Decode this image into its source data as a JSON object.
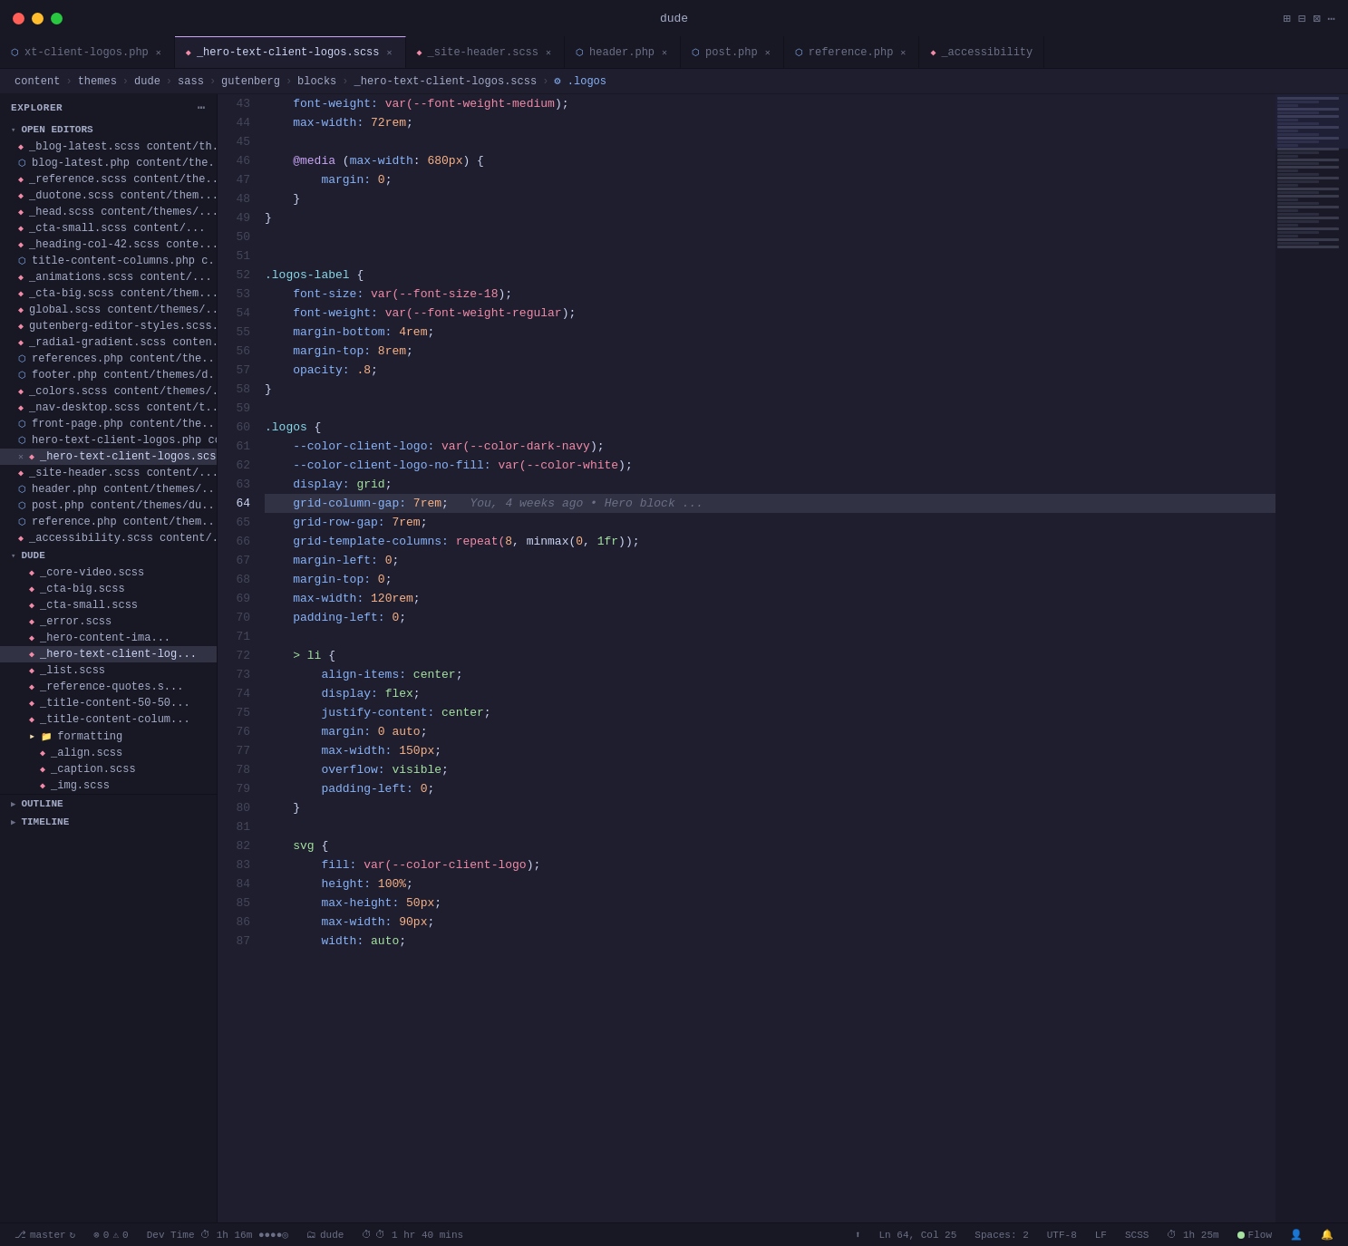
{
  "titlebar": {
    "title": "dude",
    "buttons": [
      "close",
      "minimize",
      "maximize"
    ],
    "icons": [
      "⊞",
      "⊟",
      "⊠",
      "⋯"
    ]
  },
  "tabs": [
    {
      "label": "xt-client-logos.php",
      "type": "php",
      "active": false,
      "closable": true
    },
    {
      "label": "_hero-text-client-logos.scss",
      "type": "scss",
      "active": true,
      "closable": true
    },
    {
      "label": "_site-header.scss",
      "type": "scss",
      "active": false,
      "closable": true
    },
    {
      "label": "header.php",
      "type": "php",
      "active": false,
      "closable": true
    },
    {
      "label": "post.php",
      "type": "php",
      "active": false,
      "closable": true
    },
    {
      "label": "reference.php",
      "type": "php",
      "active": false,
      "closable": true
    },
    {
      "label": "_accessibility",
      "type": "scss",
      "active": false,
      "closable": false
    }
  ],
  "breadcrumb": {
    "parts": [
      "content",
      "themes",
      "dude",
      "sass",
      "gutenberg",
      "blocks",
      "_hero-text-client-logos.scss",
      ".logos"
    ]
  },
  "sidebar": {
    "title": "EXPLORER",
    "sections": {
      "open_editors": {
        "label": "OPEN EDITORS",
        "files": [
          {
            "name": "_blog-latest.scss",
            "path": "content/th...",
            "type": "scss"
          },
          {
            "name": "blog-latest.php",
            "path": "content/the...",
            "type": "php"
          },
          {
            "name": "_reference.scss",
            "path": "content/the...",
            "type": "scss"
          },
          {
            "name": "_duotone.scss",
            "path": "content/them...",
            "type": "scss"
          },
          {
            "name": "_head.scss",
            "path": "content/themes/...",
            "type": "scss"
          },
          {
            "name": "_cta-small.scss",
            "path": "content/...",
            "type": "scss"
          },
          {
            "name": "_heading-col-42.scss",
            "path": "conte...",
            "type": "scss"
          },
          {
            "name": "title-content-columns.php",
            "path": "c...",
            "type": "php"
          },
          {
            "name": "_animations.scss",
            "path": "content/...",
            "type": "scss"
          },
          {
            "name": "_cta-big.scss",
            "path": "content/them...",
            "type": "scss"
          },
          {
            "name": "global.scss",
            "path": "content/themes/...",
            "type": "scss"
          },
          {
            "name": "gutenberg-editor-styles.scss...",
            "path": "",
            "type": "scss"
          },
          {
            "name": "_radial-gradient.scss",
            "path": "conten...",
            "type": "scss"
          },
          {
            "name": "references.php",
            "path": "content/the...",
            "type": "php"
          },
          {
            "name": "footer.php",
            "path": "content/themes/d...",
            "type": "php"
          },
          {
            "name": "_colors.scss",
            "path": "content/themes/...",
            "type": "scss"
          },
          {
            "name": "_nav-desktop.scss",
            "path": "content/t...",
            "type": "scss"
          },
          {
            "name": "front-page.php",
            "path": "content/the...",
            "type": "php"
          },
          {
            "name": "hero-text-client-logos.php",
            "path": "content/...",
            "type": "php"
          },
          {
            "name": "_hero-text-client-logos.scss...",
            "path": "",
            "type": "scss",
            "active": true,
            "modified": true
          },
          {
            "name": "_site-header.scss",
            "path": "content/...",
            "type": "scss"
          },
          {
            "name": "header.php",
            "path": "content/themes/...",
            "type": "php"
          },
          {
            "name": "post.php",
            "path": "content/themes/du...",
            "type": "php"
          },
          {
            "name": "reference.php",
            "path": "content/them...",
            "type": "php"
          },
          {
            "name": "_accessibility.scss",
            "path": "content/...",
            "type": "scss"
          }
        ]
      },
      "dude": {
        "label": "DUDE",
        "files": [
          {
            "name": "_core-video.scss",
            "indent": 1
          },
          {
            "name": "_cta-big.scss",
            "indent": 1
          },
          {
            "name": "_cta-small.scss",
            "indent": 1
          },
          {
            "name": "_error.scss",
            "indent": 1
          },
          {
            "name": "_hero-content-ima...",
            "indent": 1
          },
          {
            "name": "_hero-text-client-log...",
            "indent": 1,
            "active": true
          },
          {
            "name": "_list.scss",
            "indent": 1
          },
          {
            "name": "_reference-quotes.s...",
            "indent": 1
          },
          {
            "name": "_title-content-50-50...",
            "indent": 1
          },
          {
            "name": "_title-content-colum...",
            "indent": 1
          },
          {
            "name": "formatting",
            "indent": 1,
            "type": "folder"
          },
          {
            "name": "_align.scss",
            "indent": 2
          },
          {
            "name": "_caption.scss",
            "indent": 2
          },
          {
            "name": "_img.scss",
            "indent": 2
          }
        ]
      },
      "outline": {
        "label": "OUTLINE"
      },
      "timeline": {
        "label": "TIMELINE"
      }
    }
  },
  "code": {
    "lines": [
      {
        "num": 43,
        "content": [
          {
            "t": "    font-weight: ",
            "c": "prop"
          },
          {
            "t": "var(",
            "c": "fn"
          },
          {
            "t": "--font-weight-medium",
            "c": "fn"
          },
          {
            "t": ");",
            "c": "punct"
          }
        ]
      },
      {
        "num": 44,
        "content": [
          {
            "t": "    max-width: ",
            "c": "prop"
          },
          {
            "t": "72rem",
            "c": "num"
          },
          {
            "t": ";",
            "c": "punct"
          }
        ]
      },
      {
        "num": 45,
        "content": []
      },
      {
        "num": 46,
        "content": [
          {
            "t": "    @media ",
            "c": "at"
          },
          {
            "t": "(",
            "c": "punct"
          },
          {
            "t": "max-width",
            "c": "prop"
          },
          {
            "t": ": ",
            "c": "punct"
          },
          {
            "t": "680px",
            "c": "num"
          },
          {
            "t": ") {",
            "c": "punct"
          }
        ]
      },
      {
        "num": 47,
        "content": [
          {
            "t": "        margin: ",
            "c": "prop"
          },
          {
            "t": "0",
            "c": "num"
          },
          {
            "t": ";",
            "c": "punct"
          }
        ]
      },
      {
        "num": 48,
        "content": [
          {
            "t": "    }",
            "c": "punct"
          }
        ]
      },
      {
        "num": 49,
        "content": [
          {
            "t": "}",
            "c": "punct"
          }
        ]
      },
      {
        "num": 50,
        "content": []
      },
      {
        "num": 51,
        "content": []
      },
      {
        "num": 52,
        "content": [
          {
            "t": ".logos-label ",
            "c": "sel-class"
          },
          {
            "t": "{",
            "c": "punct"
          }
        ]
      },
      {
        "num": 53,
        "content": [
          {
            "t": "    font-size: ",
            "c": "prop"
          },
          {
            "t": "var(",
            "c": "fn"
          },
          {
            "t": "--font-size-18",
            "c": "fn"
          },
          {
            "t": ");",
            "c": "punct"
          }
        ]
      },
      {
        "num": 54,
        "content": [
          {
            "t": "    font-weight: ",
            "c": "prop"
          },
          {
            "t": "var(",
            "c": "fn"
          },
          {
            "t": "--font-weight-regular",
            "c": "fn"
          },
          {
            "t": ");",
            "c": "punct"
          }
        ]
      },
      {
        "num": 55,
        "content": [
          {
            "t": "    margin-bottom: ",
            "c": "prop"
          },
          {
            "t": "4rem",
            "c": "num"
          },
          {
            "t": ";",
            "c": "punct"
          }
        ]
      },
      {
        "num": 56,
        "content": [
          {
            "t": "    margin-top: ",
            "c": "prop"
          },
          {
            "t": "8rem",
            "c": "num"
          },
          {
            "t": ";",
            "c": "punct"
          }
        ]
      },
      {
        "num": 57,
        "content": [
          {
            "t": "    opacity: ",
            "c": "prop"
          },
          {
            "t": ".8",
            "c": "num"
          },
          {
            "t": ";",
            "c": "punct"
          }
        ]
      },
      {
        "num": 58,
        "content": [
          {
            "t": "}",
            "c": "punct"
          }
        ]
      },
      {
        "num": 59,
        "content": []
      },
      {
        "num": 60,
        "content": [
          {
            "t": ".logos ",
            "c": "sel-class"
          },
          {
            "t": "{",
            "c": "punct"
          }
        ]
      },
      {
        "num": 61,
        "content": [
          {
            "t": "    --color-client-logo: ",
            "c": "prop"
          },
          {
            "t": "var(",
            "c": "fn"
          },
          {
            "t": "--color-dark-navy",
            "c": "fn"
          },
          {
            "t": ");",
            "c": "punct"
          }
        ]
      },
      {
        "num": 62,
        "content": [
          {
            "t": "    --color-client-logo-no-fill: ",
            "c": "prop"
          },
          {
            "t": "var(",
            "c": "fn"
          },
          {
            "t": "--color-white",
            "c": "fn"
          },
          {
            "t": ");",
            "c": "punct"
          }
        ]
      },
      {
        "num": 63,
        "content": [
          {
            "t": "    display: ",
            "c": "prop"
          },
          {
            "t": "grid",
            "c": "val"
          },
          {
            "t": ";",
            "c": "punct"
          }
        ]
      },
      {
        "num": 64,
        "content": [
          {
            "t": "    grid-column-gap: ",
            "c": "prop"
          },
          {
            "t": "7rem",
            "c": "num"
          },
          {
            "t": ";",
            "c": "punct"
          },
          {
            "t": "  You, 4 weeks ago • Hero block ...",
            "c": "inline-hint"
          }
        ],
        "current": true
      },
      {
        "num": 65,
        "content": [
          {
            "t": "    grid-row-gap: ",
            "c": "prop"
          },
          {
            "t": "7rem",
            "c": "num"
          },
          {
            "t": ";",
            "c": "punct"
          }
        ]
      },
      {
        "num": 66,
        "content": [
          {
            "t": "    grid-template-columns: ",
            "c": "prop"
          },
          {
            "t": "repeat(",
            "c": "fn"
          },
          {
            "t": "8",
            "c": "num"
          },
          {
            "t": ", minmax(",
            "c": "punct"
          },
          {
            "t": "0",
            "c": "num"
          },
          {
            "t": ", ",
            "c": "punct"
          },
          {
            "t": "1fr",
            "c": "val"
          },
          {
            "t": "));",
            "c": "punct"
          }
        ]
      },
      {
        "num": 67,
        "content": [
          {
            "t": "    margin-left: ",
            "c": "prop"
          },
          {
            "t": "0",
            "c": "num"
          },
          {
            "t": ";",
            "c": "punct"
          }
        ]
      },
      {
        "num": 68,
        "content": [
          {
            "t": "    margin-top: ",
            "c": "prop"
          },
          {
            "t": "0",
            "c": "num"
          },
          {
            "t": ";",
            "c": "punct"
          }
        ]
      },
      {
        "num": 69,
        "content": [
          {
            "t": "    max-width: ",
            "c": "prop"
          },
          {
            "t": "120rem",
            "c": "num"
          },
          {
            "t": ";",
            "c": "punct"
          }
        ]
      },
      {
        "num": 70,
        "content": [
          {
            "t": "    padding-left: ",
            "c": "prop"
          },
          {
            "t": "0",
            "c": "num"
          },
          {
            "t": ";",
            "c": "punct"
          }
        ]
      },
      {
        "num": 71,
        "content": []
      },
      {
        "num": 72,
        "content": [
          {
            "t": "    > li ",
            "c": "sel"
          },
          {
            "t": "{",
            "c": "punct"
          }
        ]
      },
      {
        "num": 73,
        "content": [
          {
            "t": "        align-items: ",
            "c": "prop"
          },
          {
            "t": "center",
            "c": "val"
          },
          {
            "t": ";",
            "c": "punct"
          }
        ]
      },
      {
        "num": 74,
        "content": [
          {
            "t": "        display: ",
            "c": "prop"
          },
          {
            "t": "flex",
            "c": "val"
          },
          {
            "t": ";",
            "c": "punct"
          }
        ]
      },
      {
        "num": 75,
        "content": [
          {
            "t": "        justify-content: ",
            "c": "prop"
          },
          {
            "t": "center",
            "c": "val"
          },
          {
            "t": ";",
            "c": "punct"
          }
        ]
      },
      {
        "num": 76,
        "content": [
          {
            "t": "        margin: ",
            "c": "prop"
          },
          {
            "t": "0 auto",
            "c": "num"
          },
          {
            "t": ";",
            "c": "punct"
          }
        ]
      },
      {
        "num": 77,
        "content": [
          {
            "t": "        max-width: ",
            "c": "prop"
          },
          {
            "t": "150px",
            "c": "num"
          },
          {
            "t": ";",
            "c": "punct"
          }
        ]
      },
      {
        "num": 78,
        "content": [
          {
            "t": "        overflow: ",
            "c": "prop"
          },
          {
            "t": "visible",
            "c": "val"
          },
          {
            "t": ";",
            "c": "punct"
          }
        ]
      },
      {
        "num": 79,
        "content": [
          {
            "t": "        padding-left: ",
            "c": "prop"
          },
          {
            "t": "0",
            "c": "num"
          },
          {
            "t": ";",
            "c": "punct"
          }
        ]
      },
      {
        "num": 80,
        "content": [
          {
            "t": "    }",
            "c": "punct"
          }
        ]
      },
      {
        "num": 81,
        "content": []
      },
      {
        "num": 82,
        "content": [
          {
            "t": "    svg ",
            "c": "sel"
          },
          {
            "t": "{",
            "c": "punct"
          }
        ]
      },
      {
        "num": 83,
        "content": [
          {
            "t": "        fill: ",
            "c": "prop"
          },
          {
            "t": "var(",
            "c": "fn"
          },
          {
            "t": "--color-client-logo",
            "c": "fn"
          },
          {
            "t": ");",
            "c": "punct"
          }
        ]
      },
      {
        "num": 84,
        "content": [
          {
            "t": "        height: ",
            "c": "prop"
          },
          {
            "t": "100%",
            "c": "num"
          },
          {
            "t": ";",
            "c": "punct"
          }
        ]
      },
      {
        "num": 85,
        "content": [
          {
            "t": "        max-height: ",
            "c": "prop"
          },
          {
            "t": "50px",
            "c": "num"
          },
          {
            "t": ";",
            "c": "punct"
          }
        ]
      },
      {
        "num": 86,
        "content": [
          {
            "t": "        max-width: ",
            "c": "prop"
          },
          {
            "t": "90px",
            "c": "num"
          },
          {
            "t": ";",
            "c": "punct"
          }
        ]
      },
      {
        "num": 87,
        "content": [
          {
            "t": "        width: ",
            "c": "prop"
          },
          {
            "t": "auto",
            "c": "val"
          },
          {
            "t": ";",
            "c": "punct"
          }
        ]
      }
    ]
  },
  "statusbar": {
    "branch": "master",
    "sync_icon": "↻",
    "errors": "0",
    "warnings": "0",
    "dev_time": "Dev Time  ⏱ 1h 16m ●●●●◎",
    "folder": "dude",
    "clock": "⏱ 1 hr 40 mins",
    "ln": "Ln 64, Col 25",
    "spaces": "Spaces: 2",
    "encoding": "UTF-8",
    "eol": "LF",
    "language": "SCSS",
    "time": "⏱ 1h 25m",
    "flow": "Flow",
    "bell": "🔔"
  }
}
